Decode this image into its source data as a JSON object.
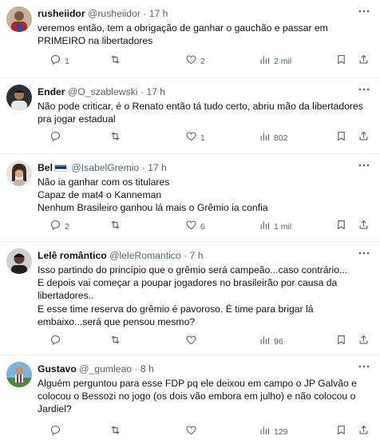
{
  "tweets": [
    {
      "name": "rusheiidor",
      "handle": "@rusheiidor",
      "time": "17 h",
      "lines": [
        "veremos então, tem a obrigação de ganhar o gauchão e passar em",
        "PRIMEIRO na libertadores"
      ],
      "replies": "1",
      "retweets": "",
      "likes": "2",
      "views": "2 mil"
    },
    {
      "name": "Ender",
      "handle": "@O_szablewski",
      "time": "17 h",
      "lines": [
        "Não pode criticar, é o Renato então tá tudo certo, abriu mão da libertadores",
        "pra jogar estadual"
      ],
      "replies": "",
      "retweets": "",
      "likes": "1",
      "views": "802"
    },
    {
      "name": "Bel",
      "handle": "@IsabelGremio",
      "time": "17 h",
      "lines": [
        "Não ia ganhar com os titulares",
        "Capaz de mat4 o Kanneman",
        "Nenhum Brasileiro ganhou lá mais o Grêmio ia confia"
      ],
      "replies": "2",
      "retweets": "",
      "likes": "6",
      "views": "1 mil"
    },
    {
      "name": "Lelê romântico",
      "handle": "@leleRomantico",
      "time": "7 h",
      "lines": [
        "Isso partindo do princípio que o grêmio será campeão...caso contrário...",
        "E depois vai começar a poupar jogadores no brasileirão por causa da",
        "libertadores..",
        "E esse time reserva do grêmio é pavoroso. É time para brigar lá",
        "embaixo...será que pensou mesmo?"
      ],
      "replies": "",
      "retweets": "",
      "likes": "",
      "views": "96"
    },
    {
      "name": "Gustavo",
      "handle": "@_gumleao",
      "time": "8 h",
      "lines": [
        "Alguém perguntou para esse FDP pq ele deixou em campo o JP Galvão e",
        "colocou o Bessozi no jogo (os dois vão embora em julho) e não colocou o",
        "Jardiel?"
      ],
      "replies": "",
      "retweets": "",
      "likes": "",
      "views": "129"
    }
  ],
  "colors": {
    "text": "#0f1419",
    "secondary": "#536471",
    "divider": "#eff3f4"
  },
  "icons": [
    "more-icon",
    "reply-icon",
    "retweet-icon",
    "like-icon",
    "views-icon",
    "bookmark-icon",
    "share-icon"
  ]
}
